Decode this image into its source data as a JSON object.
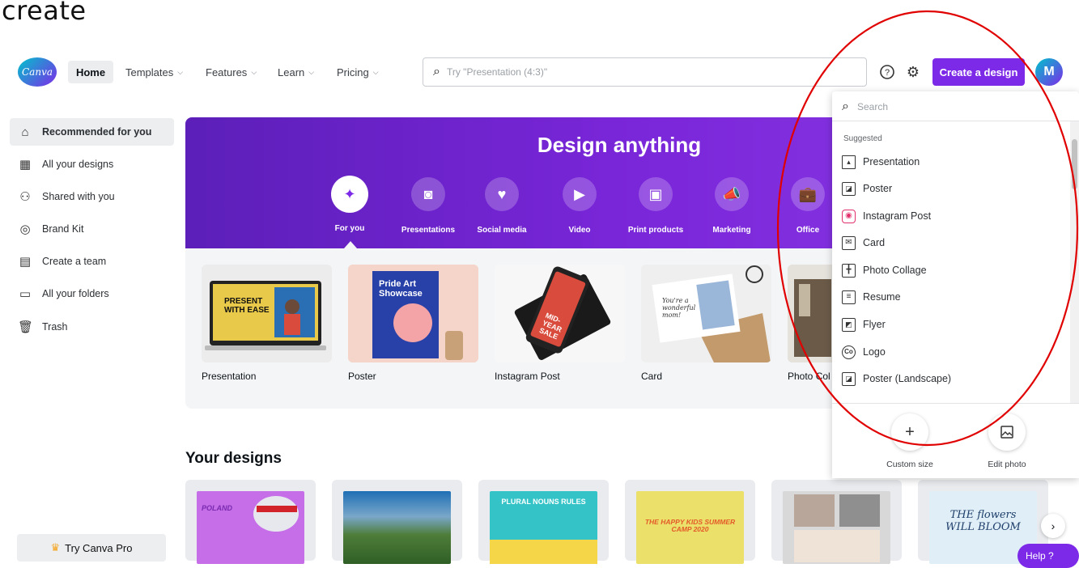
{
  "caption": "create",
  "header": {
    "logo_text": "Canva",
    "home": "Home",
    "nav": [
      "Templates",
      "Features",
      "Learn",
      "Pricing"
    ],
    "search_placeholder": "Try \"Presentation (4:3)\"",
    "create_button": "Create a design",
    "avatar_initial": "M",
    "icons": [
      "help-icon",
      "gear-icon"
    ]
  },
  "sidebar": {
    "items": [
      {
        "label": "Recommended for you",
        "icon": "home-icon"
      },
      {
        "label": "All your designs",
        "icon": "grid-icon"
      },
      {
        "label": "Shared with you",
        "icon": "people-icon"
      },
      {
        "label": "Brand Kit",
        "icon": "brand-icon"
      },
      {
        "label": "Create a team",
        "icon": "team-icon"
      },
      {
        "label": "All your folders",
        "icon": "folder-icon"
      },
      {
        "label": "Trash",
        "icon": "trash-icon"
      }
    ],
    "try_pro": "Try Canva Pro"
  },
  "hero": {
    "title": "Design anything",
    "categories": [
      "For you",
      "Presentations",
      "Social media",
      "Video",
      "Print products",
      "Marketing",
      "Office"
    ]
  },
  "cards": [
    "Presentation",
    "Poster",
    "Instagram Post",
    "Card",
    "Photo Col"
  ],
  "card_texts": {
    "presentation": "PRESENT WITH EASE",
    "poster": "Pride Art Showcase",
    "instagram": "MID-YEAR SALE",
    "card": "You're a wonderful mom!"
  },
  "your_designs": {
    "title": "Your designs",
    "thumbs": [
      "POLAND",
      "",
      "PLURAL NOUNS RULES",
      "THE HAPPY KIDS SUMMER CAMP 2020",
      "",
      "THE flowers WILL BLOOM"
    ]
  },
  "help_label": "Help ?",
  "dropdown": {
    "search_placeholder": "Search",
    "heading": "Suggested",
    "items": [
      {
        "label": "Presentation",
        "icon": "presentation-icon"
      },
      {
        "label": "Poster",
        "icon": "poster-icon"
      },
      {
        "label": "Instagram Post",
        "icon": "instagram-icon"
      },
      {
        "label": "Card",
        "icon": "card-icon"
      },
      {
        "label": "Photo Collage",
        "icon": "collage-icon"
      },
      {
        "label": "Resume",
        "icon": "resume-icon"
      },
      {
        "label": "Flyer",
        "icon": "flyer-icon"
      },
      {
        "label": "Logo",
        "icon": "logo-icon"
      },
      {
        "label": "Poster (Landscape)",
        "icon": "poster-landscape-icon"
      }
    ],
    "footer": [
      {
        "label": "Custom size",
        "icon": "plus-icon"
      },
      {
        "label": "Edit photo",
        "icon": "edit-photo-icon"
      }
    ]
  },
  "colors": {
    "accent": "#7d2ae8",
    "annotation": "#e00000"
  }
}
